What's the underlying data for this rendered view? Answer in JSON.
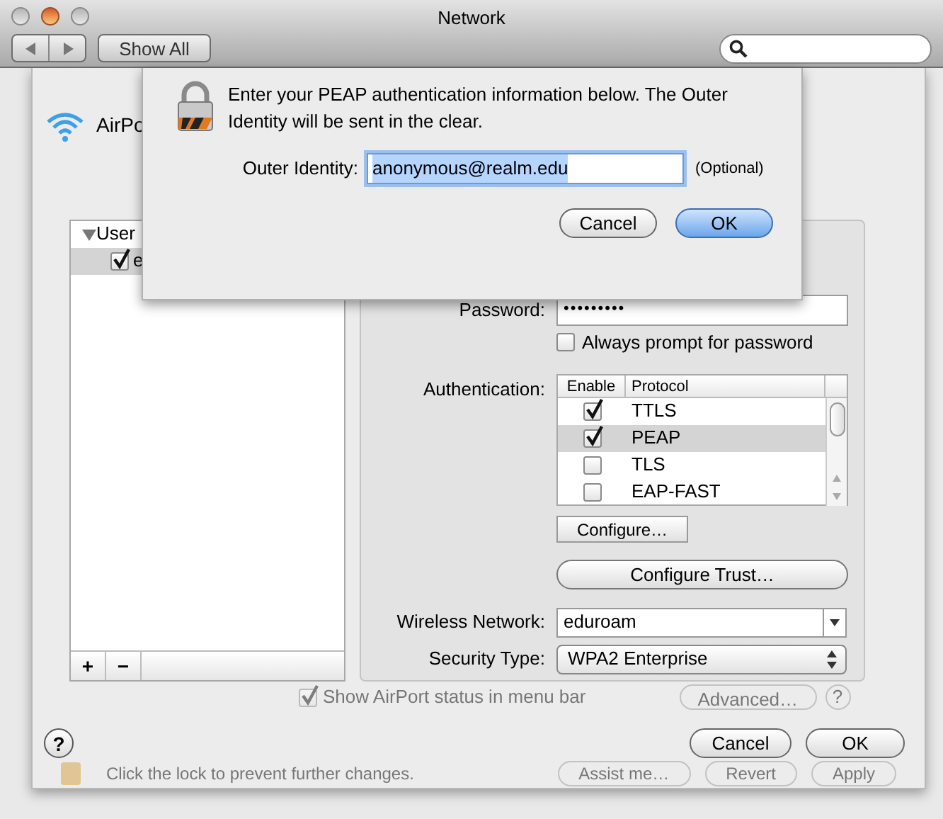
{
  "window": {
    "title": "Network"
  },
  "toolbar": {
    "show_all": "Show All"
  },
  "sheet": {
    "service_name": "AirPo",
    "profiles": [
      {
        "label": "User",
        "expanded": true,
        "children": [
          {
            "label": "e",
            "checked": true,
            "selected": true
          }
        ]
      }
    ],
    "list_buttons": [
      "+",
      "−"
    ],
    "password": {
      "label": "Password:",
      "value": "•••••••••"
    },
    "always_prompt": {
      "label": "Always prompt for password",
      "checked": false
    },
    "authentication": {
      "label": "Authentication:",
      "columns": [
        "Enable",
        "Protocol"
      ],
      "rows": [
        {
          "protocol": "TTLS",
          "checked": true,
          "selected": false
        },
        {
          "protocol": "PEAP",
          "checked": true,
          "selected": true
        },
        {
          "protocol": "TLS",
          "checked": false,
          "selected": false
        },
        {
          "protocol": "EAP-FAST",
          "checked": false,
          "selected": false
        }
      ]
    },
    "configure": "Configure…",
    "configure_trust": "Configure Trust…",
    "wireless_network": {
      "label": "Wireless Network:",
      "value": "eduroam"
    },
    "security_type": {
      "label": "Security Type:",
      "value": "WPA2 Enterprise"
    },
    "help": "?",
    "buttons": [
      "Cancel",
      "OK"
    ]
  },
  "dialog": {
    "message": "Enter your PEAP authentication information below. The Outer Identity will be sent in the clear.",
    "outer_identity": {
      "label": "Outer Identity:",
      "value": "anonymous@realm.edu",
      "hint": "(Optional)"
    },
    "buttons": [
      {
        "label": "Cancel",
        "default": false
      },
      {
        "label": "OK",
        "default": true
      }
    ]
  },
  "background": {
    "show_status": {
      "label": "Show AirPort status in menu bar",
      "checked": true
    },
    "advanced": "Advanced…",
    "help": "?",
    "lock_message": "Click the lock to prevent further changes.",
    "buttons": [
      "Assist me…",
      "Revert",
      "Apply"
    ]
  }
}
